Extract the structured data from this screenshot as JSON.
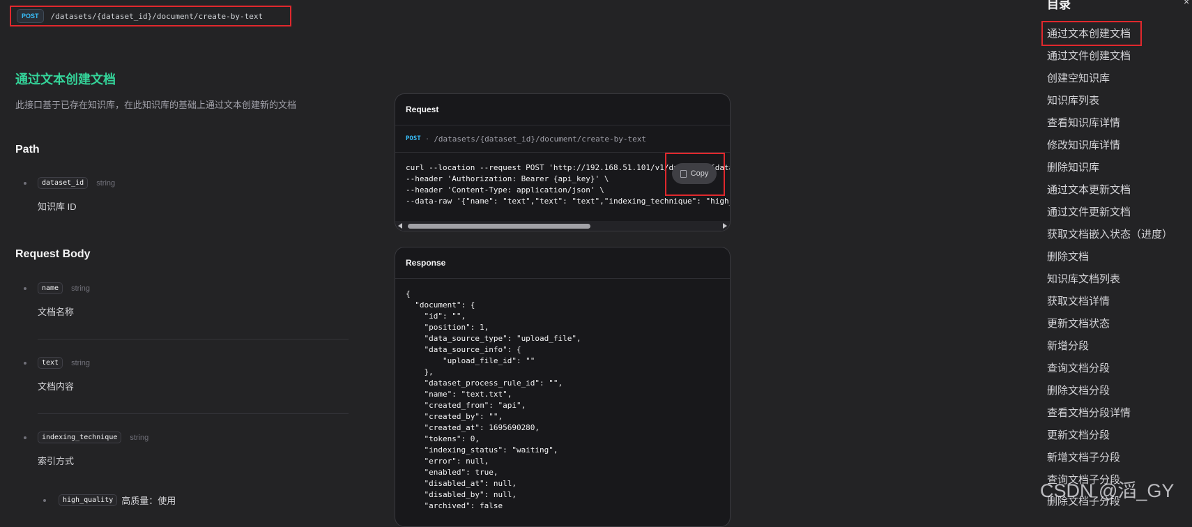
{
  "endpoint": {
    "method": "POST",
    "path": "/datasets/{dataset_id}/document/create-by-text"
  },
  "doc": {
    "title": "通过文本创建文档",
    "description": "此接口基于已存在知识库，在此知识库的基础上通过文本创建新的文档",
    "path_heading": "Path",
    "path_params": [
      {
        "name": "dataset_id",
        "type": "string",
        "desc": "知识库 ID"
      }
    ],
    "body_heading": "Request Body",
    "body_params": [
      {
        "name": "name",
        "type": "string",
        "desc": "文档名称"
      },
      {
        "name": "text",
        "type": "string",
        "desc": "文档内容"
      },
      {
        "name": "indexing_technique",
        "type": "string",
        "desc": "索引方式"
      }
    ],
    "sub_param": {
      "name": "high_quality",
      "desc": "高质量：使用"
    }
  },
  "request_panel": {
    "title": "Request",
    "method": "POST",
    "separator": "·",
    "path": "/datasets/{dataset_id}/document/create-by-text",
    "code": "curl --location --request POST 'http://192.168.51.101/v1/datasets/{dataset_id}/document/create-by-text' \\\n--header 'Authorization: Bearer {api_key}' \\\n--header 'Content-Type: application/json' \\\n--data-raw '{\"name\": \"text\",\"text\": \"text\",\"indexing_technique\": \"high_quality\"}'",
    "copy_label": "Copy"
  },
  "response_panel": {
    "title": "Response",
    "code": "{\n  \"document\": {\n    \"id\": \"\",\n    \"position\": 1,\n    \"data_source_type\": \"upload_file\",\n    \"data_source_info\": {\n        \"upload_file_id\": \"\"\n    },\n    \"dataset_process_rule_id\": \"\",\n    \"name\": \"text.txt\",\n    \"created_from\": \"api\",\n    \"created_by\": \"\",\n    \"created_at\": 1695690280,\n    \"tokens\": 0,\n    \"indexing_status\": \"waiting\",\n    \"error\": null,\n    \"enabled\": true,\n    \"disabled_at\": null,\n    \"disabled_by\": null,\n    \"archived\": false"
  },
  "toc": {
    "title": "目录",
    "close": "×",
    "items": [
      "通过文本创建文档",
      "通过文件创建文档",
      "创建空知识库",
      "知识库列表",
      "查看知识库详情",
      "修改知识库详情",
      "删除知识库",
      "通过文本更新文档",
      "通过文件更新文档",
      "获取文档嵌入状态（进度）",
      "删除文档",
      "知识库文档列表",
      "获取文档详情",
      "更新文档状态",
      "新增分段",
      "查询文档分段",
      "删除文档分段",
      "查看文档分段详情",
      "更新文档分段",
      "新增文档子分段",
      "查询文档子分段",
      "删除文档子分段"
    ]
  },
  "watermark": "CSDN @滔_GY"
}
